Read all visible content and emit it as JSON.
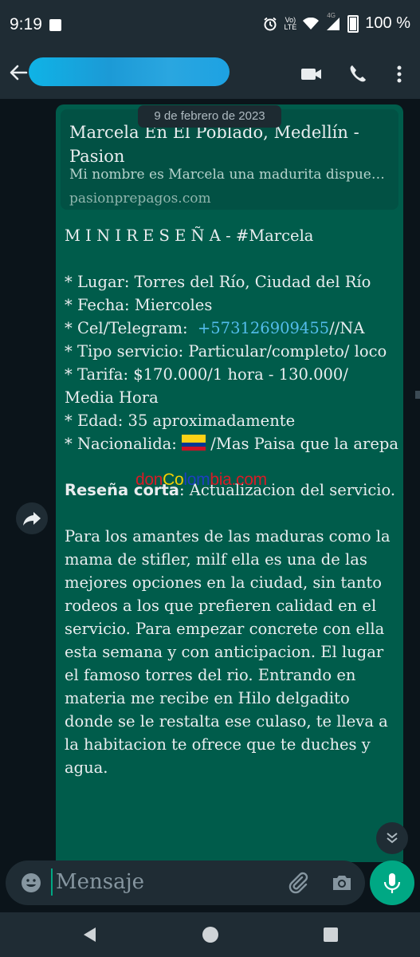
{
  "status_bar": {
    "time": "9:19",
    "network_top": "Vo)",
    "network_bottom": "LTE",
    "signal_label": "4G",
    "battery": "100 %"
  },
  "app_bar": {
    "contact_name": ""
  },
  "link_preview": {
    "title": "Marcela En El Poblado, Medellín - Pasion",
    "description": "Mi nombre es Marcela una madurita dispuesta a complacerte...",
    "domain": "pasionprepagos.com"
  },
  "date_chip": "9 de febrero de 2023",
  "message": {
    "heading": "M I N I R E S E Ñ A - #Marcela",
    "lines": {
      "lugar": "* Lugar: Torres del Río, Ciudad del Río",
      "fecha": "* Fecha: Miercoles",
      "cel_prefix": "* Cel/Telegram:  ",
      "cel_phone": "+573126909455",
      "cel_suffix": "//NA",
      "tipo": "* Tipo servicio: Particular/completo/ loco",
      "tarifa": "* Tarifa: $170.000/1 hora - 130.000/ Media Hora",
      "edad": "* Edad: 35 aproximadamente",
      "nac_prefix": "* Nacionalida: ",
      "nac_suffix": " /Mas Paisa que la arepa"
    },
    "resena_label": "Reseña corta",
    "resena_text": ": Actualizacion del servicio.",
    "body": "Para los amantes de las maduras como la mama de stifler, milf ella es una de las mejores opciones en la ciudad, sin tanto rodeos a los que prefieren calidad en el servicio. Para empezar concrete con ella esta semana y con anticipacion. El lugar el famoso torres del rio. Entrando en materia me recibe en Hilo delgadito donde se le restalta ese culaso, te lleva a la habitacion te ofrece que te duches y agua."
  },
  "watermark": {
    "part1": "don",
    "part2": "Co",
    "part3": "lom",
    "part4": "bia",
    "part5": ".com"
  },
  "input": {
    "placeholder": "Mensaje"
  },
  "colors": {
    "accent": "#00a884",
    "bubble": "#005c4b",
    "link": "#53bdeb",
    "bar": "#1f2c34"
  }
}
